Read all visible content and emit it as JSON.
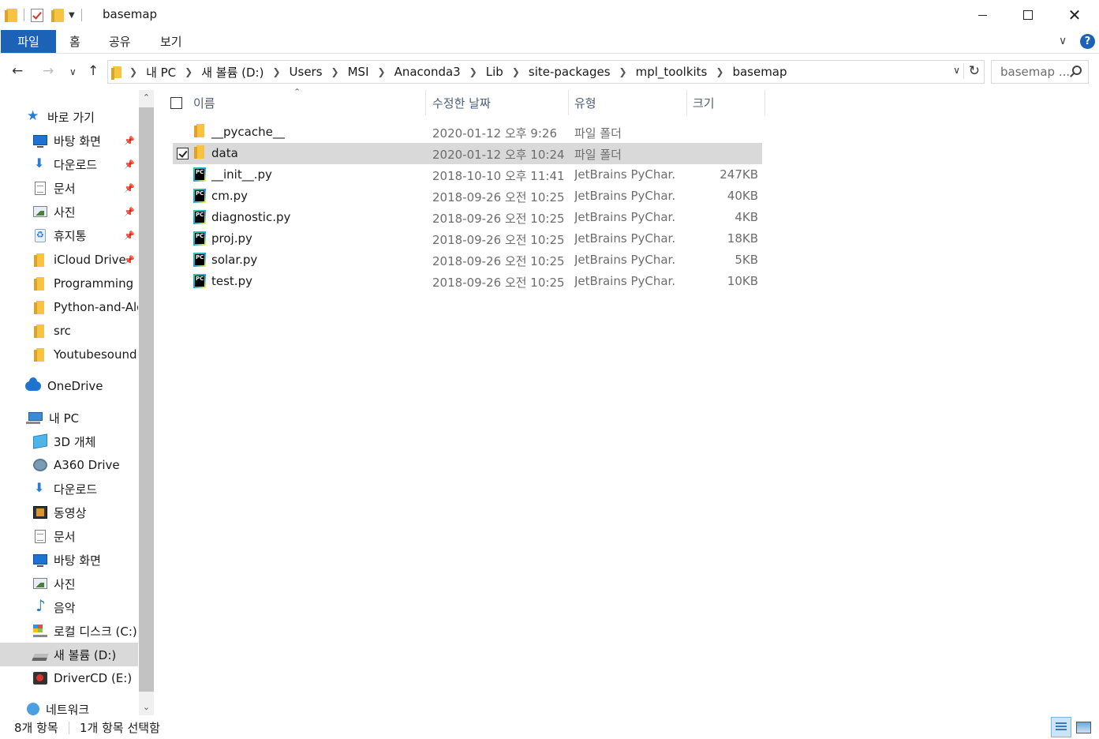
{
  "window": {
    "title": "basemap"
  },
  "ribbon": {
    "tabs": [
      {
        "label": "파일",
        "active": true
      },
      {
        "label": "홈"
      },
      {
        "label": "공유"
      },
      {
        "label": "보기"
      }
    ],
    "help_label": "?"
  },
  "address": {
    "crumbs": [
      "내 PC",
      "새 볼륨 (D:)",
      "Users",
      "MSI",
      "Anaconda3",
      "Lib",
      "site-packages",
      "mpl_toolkits",
      "basemap"
    ],
    "search_placeholder": "basemap ..."
  },
  "navpane": {
    "items": [
      {
        "label": "바로 가기",
        "icon": "star-icon",
        "level": 0,
        "pinned": false
      },
      {
        "label": "바탕 화면",
        "icon": "desktop-icon",
        "level": 1,
        "pinned": true
      },
      {
        "label": "다운로드",
        "icon": "download-icon",
        "level": 1,
        "pinned": true
      },
      {
        "label": "문서",
        "icon": "document-icon",
        "level": 1,
        "pinned": true
      },
      {
        "label": "사진",
        "icon": "picture-icon",
        "level": 1,
        "pinned": true
      },
      {
        "label": "휴지통",
        "icon": "recycle-bin-icon",
        "level": 1,
        "pinned": true
      },
      {
        "label": "iCloud Drive",
        "icon": "folder-icon",
        "level": 1,
        "pinned": true
      },
      {
        "label": "Programming",
        "icon": "folder-icon",
        "level": 1,
        "pinned": false
      },
      {
        "label": "Python-and-Alg",
        "icon": "folder-icon",
        "level": 1,
        "pinned": false
      },
      {
        "label": "src",
        "icon": "folder-icon",
        "level": 1,
        "pinned": false
      },
      {
        "label": "Youtubesound",
        "icon": "folder-icon",
        "level": 1,
        "pinned": false
      },
      {
        "label": "OneDrive",
        "icon": "onedrive-icon",
        "level": 0,
        "pinned": false
      },
      {
        "label": "내 PC",
        "icon": "pc-icon",
        "level": 0,
        "pinned": false
      },
      {
        "label": "3D 개체",
        "icon": "3d-objects-icon",
        "level": 1,
        "pinned": false
      },
      {
        "label": "A360 Drive",
        "icon": "a360-icon",
        "level": 1,
        "pinned": false
      },
      {
        "label": "다운로드",
        "icon": "download-icon",
        "level": 1,
        "pinned": false
      },
      {
        "label": "동영상",
        "icon": "video-icon",
        "level": 1,
        "pinned": false
      },
      {
        "label": "문서",
        "icon": "document-icon",
        "level": 1,
        "pinned": false
      },
      {
        "label": "바탕 화면",
        "icon": "desktop-icon",
        "level": 1,
        "pinned": false
      },
      {
        "label": "사진",
        "icon": "picture-icon",
        "level": 1,
        "pinned": false
      },
      {
        "label": "음악",
        "icon": "music-icon",
        "level": 1,
        "pinned": false
      },
      {
        "label": "로컬 디스크 (C:)",
        "icon": "local-disk-icon",
        "level": 1,
        "pinned": false
      },
      {
        "label": "새 볼륨 (D:)",
        "icon": "drive-icon",
        "level": 1,
        "pinned": false,
        "selected": true
      },
      {
        "label": "DriverCD (E:)",
        "icon": "cd-drive-icon",
        "level": 1,
        "pinned": false
      },
      {
        "label": "네트워크",
        "icon": "network-icon",
        "level": 0,
        "pinned": false
      }
    ]
  },
  "columns": {
    "name": "이름",
    "date": "수정한 날짜",
    "type": "유형",
    "size": "크기"
  },
  "files": [
    {
      "name": "__pycache__",
      "date": "2020-01-12 오후 9:26",
      "type": "파일 폴더",
      "size": "",
      "icon": "folder-icon",
      "selected": false
    },
    {
      "name": "data",
      "date": "2020-01-12 오후 10:24",
      "type": "파일 폴더",
      "size": "",
      "icon": "folder-icon",
      "selected": true
    },
    {
      "name": "__init__.py",
      "date": "2018-10-10 오후 11:41",
      "type": "JetBrains PyChar...",
      "size": "247KB",
      "icon": "pycharm-file-icon",
      "selected": false
    },
    {
      "name": "cm.py",
      "date": "2018-09-26 오전 10:25",
      "type": "JetBrains PyChar...",
      "size": "40KB",
      "icon": "pycharm-file-icon",
      "selected": false
    },
    {
      "name": "diagnostic.py",
      "date": "2018-09-26 오전 10:25",
      "type": "JetBrains PyChar...",
      "size": "4KB",
      "icon": "pycharm-file-icon",
      "selected": false
    },
    {
      "name": "proj.py",
      "date": "2018-09-26 오전 10:25",
      "type": "JetBrains PyChar...",
      "size": "18KB",
      "icon": "pycharm-file-icon",
      "selected": false
    },
    {
      "name": "solar.py",
      "date": "2018-09-26 오전 10:25",
      "type": "JetBrains PyChar...",
      "size": "5KB",
      "icon": "pycharm-file-icon",
      "selected": false
    },
    {
      "name": "test.py",
      "date": "2018-09-26 오전 10:25",
      "type": "JetBrains PyChar...",
      "size": "10KB",
      "icon": "pycharm-file-icon",
      "selected": false
    }
  ],
  "status": {
    "item_count": "8개 항목",
    "selection": "1개 항목 선택함"
  }
}
